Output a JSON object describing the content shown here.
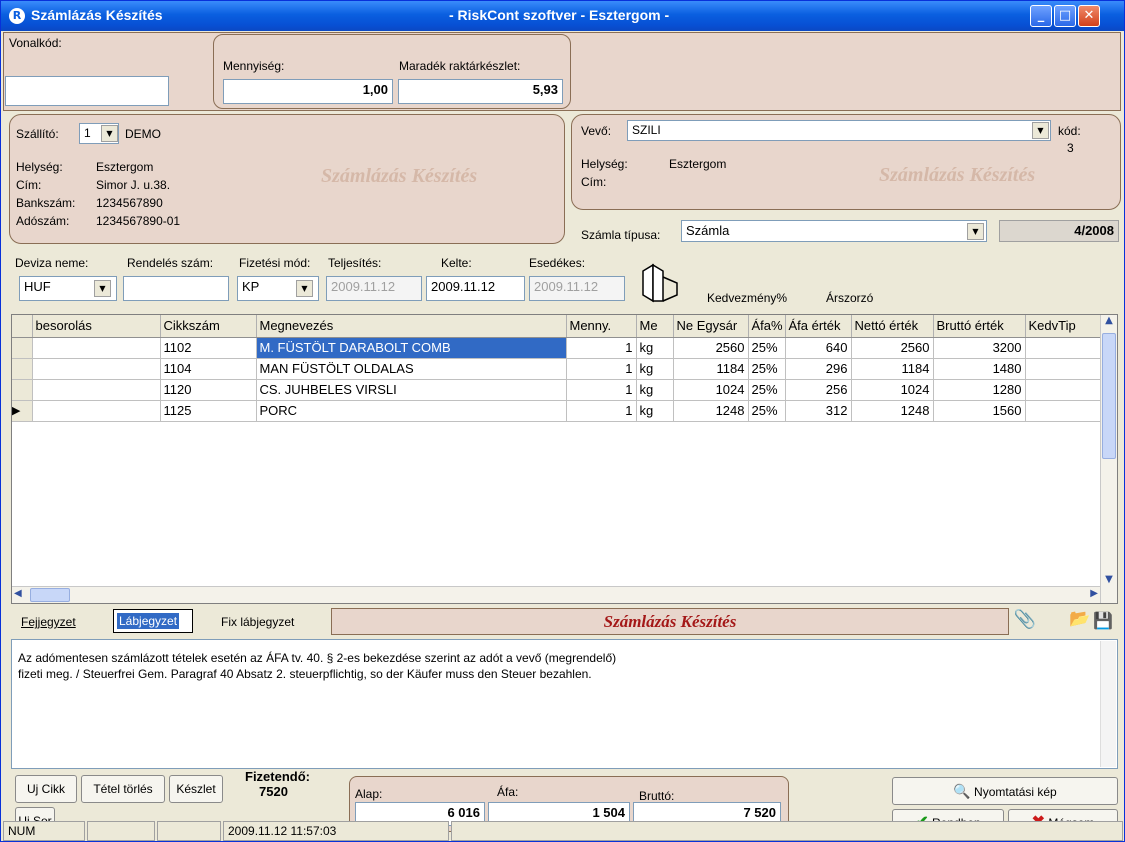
{
  "window": {
    "title_left": "Számlázás Készítés",
    "title_center": "- RiskCont szoftver - Esztergom -",
    "app_icon": "R"
  },
  "top": {
    "barcode_label": "Vonalkód:",
    "barcode_value": "",
    "quantity_label": "Mennyiség:",
    "quantity_value": "1,00",
    "stock_label": "Maradék raktárkészlet:",
    "stock_value": "5,93"
  },
  "supplier": {
    "label": "Szállító:",
    "id": "1",
    "name": "DEMO",
    "city_label": "Helység:",
    "city": "Esztergom",
    "address_label": "Cím:",
    "address": "Simor J. u.38.",
    "bank_label": "Bankszám:",
    "bank": "1234567890",
    "tax_label": "Adószám:",
    "tax": "1234567890-01",
    "watermark": "Számlázás Készítés"
  },
  "buyer": {
    "label": "Vevő:",
    "name": "SZILI",
    "code_label": "kód:",
    "code": "3",
    "city_label": "Helység:",
    "city": "Esztergom",
    "address_label": "Cím:",
    "address": "",
    "watermark": "Számlázás Készítés",
    "invoice_type_label": "Számla típusa:",
    "invoice_type": "Számla",
    "invoice_number": "4/2008"
  },
  "options": {
    "currency_label": "Deviza neme:",
    "currency": "HUF",
    "order_label": "Rendelés szám:",
    "order_value": "",
    "payment_label": "Fizetési mód:",
    "payment": "KP",
    "fulfil_label": "Teljesítés:",
    "fulfil": "2009.11.12",
    "issue_label": "Kelte:",
    "issue": "2009.11.12",
    "due_label": "Esedékes:",
    "due": "2009.11.12",
    "discount_label": "Kedvezmény%",
    "multiplier_label": "Árszorzó"
  },
  "table": {
    "columns": [
      "besorolás",
      "Cikkszám",
      "Megnevezés",
      "Menny.",
      "Me",
      "Ne Egysár",
      "Áfa%",
      "Áfa érték",
      "Nettó érték",
      "Bruttó érték",
      "KedvTip"
    ],
    "rows": [
      [
        "",
        "1102",
        "M. FÜSTÖLT DARABOLT COMB",
        "1",
        "kg",
        "2560",
        "25%",
        "640",
        "2560",
        "3200",
        ""
      ],
      [
        "",
        "1104",
        " MAN FÜSTÖLT OLDALAS",
        "1",
        "kg",
        "1184",
        "25%",
        "296",
        "1184",
        "1480",
        ""
      ],
      [
        "",
        "1120",
        "CS. JUHBELES VIRSLI",
        "1",
        "kg",
        "1024",
        "25%",
        "256",
        "1024",
        "1280",
        ""
      ],
      [
        "",
        "1125",
        "PORC",
        "1",
        "kg",
        "1248",
        "25%",
        "312",
        "1248",
        "1560",
        ""
      ]
    ]
  },
  "tabs": {
    "header_note": "Fejjegyzet",
    "footer_note": "Lábjegyzet",
    "fixed_footer": "Fix lábjegyzet",
    "banner": "Számlázás Készítés"
  },
  "note_text_1": "Az adómentesen számlázott tételek esetén az ÁFA tv. 40. § 2-es bekezdése szerint az adót a vevő (megrendelő)",
  "note_text_2": " fizeti meg. / Steuerfrei Gem. Paragraf 40 Absatz 2. steuerpflichtig, so der Käufer muss den Steuer bezahlen.",
  "buttons": {
    "new_item": "Uj Cikk",
    "delete_item": "Tétel törlés",
    "stock": "Készlet",
    "new_row": "Uj Sor",
    "print_preview": "Nyomtatási kép",
    "ok": "Rendben",
    "cancel": "Mégsem"
  },
  "totals": {
    "payable_label": "Fizetendő:",
    "payable": "7520",
    "base_label": "Alap:",
    "base": "6 016",
    "vat_label": "Áfa:",
    "vat": "1 504",
    "gross_label": "Bruttó:",
    "gross": "7 520"
  },
  "status": {
    "num": "NUM",
    "datetime": "2009.11.12 11:57:03"
  }
}
